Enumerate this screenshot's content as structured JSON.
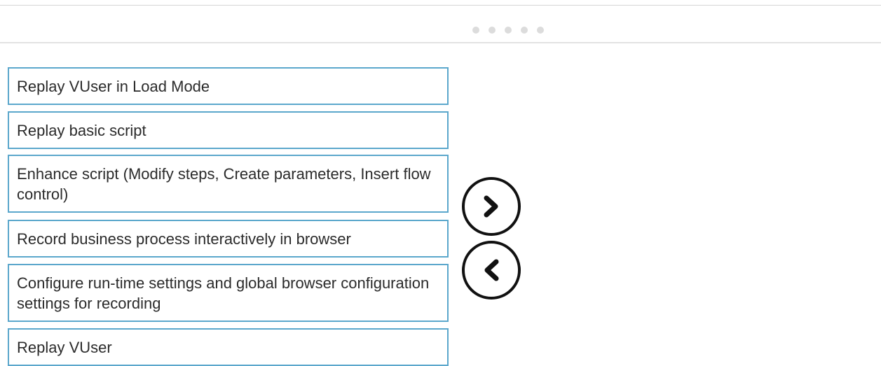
{
  "pager": {
    "dot_count": 5
  },
  "items": [
    {
      "label": "Replay VUser in Load Mode"
    },
    {
      "label": "Replay basic script"
    },
    {
      "label": "Enhance script (Modify steps, Create parameters, Insert flow control)"
    },
    {
      "label": "Record business process interactively in browser"
    },
    {
      "label": "Configure run-time settings and global browser configuration settings for recording"
    },
    {
      "label": "Replay VUser"
    }
  ],
  "controls": {
    "move_right_icon": "chevron-right-icon",
    "move_left_icon": "chevron-left-icon"
  },
  "colors": {
    "item_border": "#5ba7cc",
    "item_text": "#2b2b2b",
    "arrow": "#111111",
    "pager_dot": "#dcdcdc"
  }
}
